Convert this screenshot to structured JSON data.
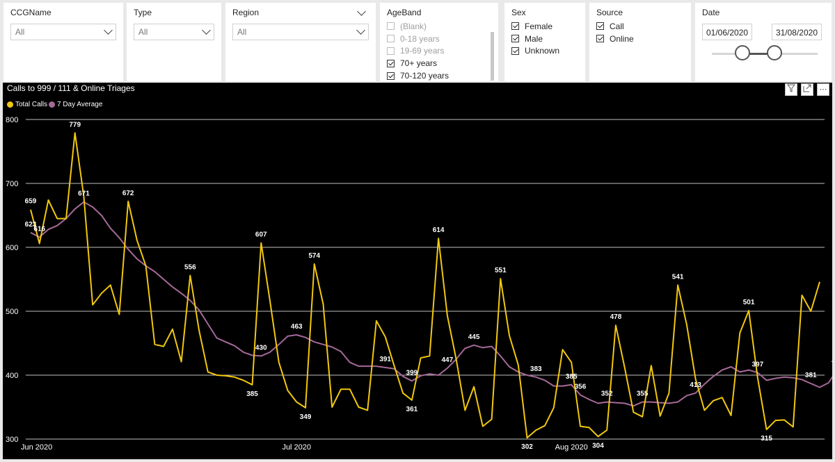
{
  "slicers": {
    "ccg": {
      "title": "CCGName",
      "value": "All"
    },
    "type": {
      "title": "Type",
      "value": "All"
    },
    "region": {
      "title": "Region",
      "value": "All"
    },
    "ageband": {
      "title": "AgeBand",
      "items": [
        {
          "label": "(Blank)",
          "checked": false
        },
        {
          "label": "0-18 years",
          "checked": false
        },
        {
          "label": "19-69 years",
          "checked": false
        },
        {
          "label": "70+ years",
          "checked": true
        },
        {
          "label": "70-120 years",
          "checked": true
        }
      ]
    },
    "sex": {
      "title": "Sex",
      "items": [
        {
          "label": "Female",
          "checked": true
        },
        {
          "label": "Male",
          "checked": true
        },
        {
          "label": "Unknown",
          "checked": true
        }
      ]
    },
    "source": {
      "title": "Source",
      "items": [
        {
          "label": "Call",
          "checked": true
        },
        {
          "label": "Online",
          "checked": true
        }
      ]
    },
    "date": {
      "title": "Date",
      "start": "01/06/2020",
      "end": "31/08/2020"
    }
  },
  "visual_icons": [
    "filter-icon",
    "focus-mode-icon",
    "more-options-icon"
  ],
  "chart_data": {
    "type": "line",
    "title": "Calls to 999 / 111 & Online Triages",
    "xlabel": "",
    "ylabel": "",
    "ylim": [
      300,
      800
    ],
    "yticks": [
      300,
      400,
      500,
      600,
      700,
      800
    ],
    "grid": true,
    "legend_position": "top-left",
    "x_tick_labels": [
      {
        "label": "Jun 2020",
        "day": 0
      },
      {
        "label": "Jul 2020",
        "day": 30
      },
      {
        "label": "Aug 2020",
        "day": 61
      }
    ],
    "x_start": "2020-06-01",
    "x_end": "2020-08-31",
    "series": [
      {
        "name": "Total Calls",
        "color": "#F2C80F",
        "values": [
          659,
          606,
          674,
          645,
          645,
          779,
          680,
          510,
          528,
          541,
          495,
          672,
          611,
          571,
          448,
          445,
          472,
          421,
          556,
          470,
          405,
          400,
          399,
          397,
          392,
          385,
          607,
          516,
          420,
          376,
          358,
          349,
          574,
          511,
          350,
          378,
          378,
          350,
          345,
          485,
          460,
          415,
          372,
          361,
          427,
          430,
          614,
          493,
          425,
          345,
          382,
          320,
          331,
          551,
          462,
          416,
          302,
          314,
          321,
          349,
          440,
          420,
          320,
          318,
          304,
          314,
          478,
          412,
          342,
          335,
          415,
          336,
          372,
          541,
          479,
          394,
          345,
          360,
          365,
          337,
          466,
          501,
          396,
          315,
          329,
          330,
          319,
          525,
          500,
          546
        ]
      },
      {
        "name": "7 Day Average",
        "color": "#A66999",
        "values": [
          623,
          616,
          628,
          634,
          645,
          660,
          671,
          663,
          650,
          630,
          615,
          597,
          582,
          571,
          562,
          550,
          538,
          528,
          517,
          502,
          480,
          458,
          452,
          446,
          436,
          431,
          430,
          436,
          448,
          461,
          463,
          459,
          452,
          448,
          444,
          437,
          420,
          414,
          414,
          414,
          412,
          410,
          398,
          391,
          399,
          402,
          400,
          411,
          425,
          442,
          447,
          443,
          445,
          430,
          413,
          405,
          400,
          397,
          392,
          383,
          383,
          385,
          369,
          362,
          356,
          358,
          357,
          356,
          352,
          358,
          358,
          357,
          356,
          358,
          368,
          372,
          386,
          398,
          408,
          413,
          405,
          408,
          404,
          392,
          395,
          397,
          396,
          393,
          387,
          381,
          388,
          409
        ]
      }
    ],
    "data_labels": [
      {
        "day": 0,
        "value": 659,
        "series": "Total Calls"
      },
      {
        "day": 0,
        "value": 623,
        "series": "7 Day Average"
      },
      {
        "day": 1,
        "value": 616,
        "series": "7 Day Average"
      },
      {
        "day": 5,
        "value": 779,
        "series": "Total Calls"
      },
      {
        "day": 6,
        "value": 671,
        "series": "7 Day Average"
      },
      {
        "day": 11,
        "value": 672,
        "series": "Total Calls"
      },
      {
        "day": 18,
        "value": 556,
        "series": "Total Calls"
      },
      {
        "day": 25,
        "value": 385,
        "series": "Total Calls"
      },
      {
        "day": 26,
        "value": 430,
        "series": "7 Day Average"
      },
      {
        "day": 26,
        "value": 607,
        "series": "Total Calls"
      },
      {
        "day": 30,
        "value": 463,
        "series": "7 Day Average"
      },
      {
        "day": 31,
        "value": 349,
        "series": "Total Calls"
      },
      {
        "day": 32,
        "value": 574,
        "series": "Total Calls"
      },
      {
        "day": 40,
        "value": 391,
        "series": "7 Day Average"
      },
      {
        "day": 43,
        "value": 361,
        "series": "Total Calls"
      },
      {
        "day": 43,
        "value": 399,
        "series": "7 Day Average"
      },
      {
        "day": 46,
        "value": 614,
        "series": "Total Calls"
      },
      {
        "day": 47,
        "value": 447,
        "series": "7 Day Average"
      },
      {
        "day": 50,
        "value": 445,
        "series": "7 Day Average"
      },
      {
        "day": 53,
        "value": 551,
        "series": "Total Calls"
      },
      {
        "day": 56,
        "value": 302,
        "series": "Total Calls"
      },
      {
        "day": 57,
        "value": 383,
        "series": "7 Day Average"
      },
      {
        "day": 61,
        "value": 385,
        "series": "7 Day Average"
      },
      {
        "day": 62,
        "value": 356,
        "series": "7 Day Average"
      },
      {
        "day": 64,
        "value": 304,
        "series": "Total Calls"
      },
      {
        "day": 65,
        "value": 352,
        "series": "7 Day Average"
      },
      {
        "day": 66,
        "value": 478,
        "series": "Total Calls"
      },
      {
        "day": 69,
        "value": 355,
        "series": "7 Day Average"
      },
      {
        "day": 73,
        "value": 541,
        "series": "Total Calls"
      },
      {
        "day": 75,
        "value": 413,
        "series": "7 Day Average"
      },
      {
        "day": 81,
        "value": 501,
        "series": "Total Calls"
      },
      {
        "day": 82,
        "value": 397,
        "series": "7 Day Average"
      },
      {
        "day": 83,
        "value": 315,
        "series": "Total Calls"
      },
      {
        "day": 88,
        "value": 381,
        "series": "7 Day Average"
      },
      {
        "day": 91,
        "value": 546,
        "series": "Total Calls"
      },
      {
        "day": 91,
        "value": 409,
        "series": "7 Day Average"
      }
    ]
  }
}
